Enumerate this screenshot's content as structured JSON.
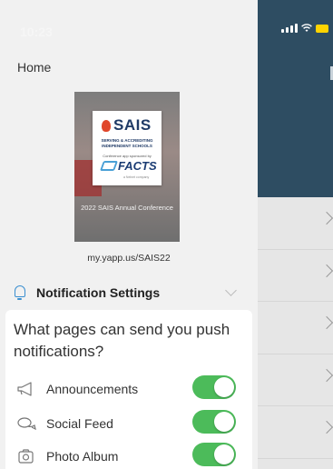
{
  "status_bar": {
    "time": "10:23"
  },
  "drawer": {
    "home_label": "Home",
    "cover": {
      "logo_text": "SAIS",
      "tagline": "SERVING & ACCREDITING INDEPENDENT SCHOOLS",
      "sponsor_text": "Conference app sponsored by",
      "sponsor_logo": "FACTS",
      "sponsor_byline": "a Nelnet company",
      "caption": "2022 SAIS Annual Conference"
    },
    "url": "my.yapp.us/SAIS22",
    "notifications": {
      "title": "Notification Settings",
      "question": "What pages can send you push notifications?",
      "options": [
        {
          "icon": "megaphone-icon",
          "label": "Announcements",
          "enabled": true
        },
        {
          "icon": "chat-bubbles-icon",
          "label": "Social Feed",
          "enabled": true
        },
        {
          "icon": "camera-icon",
          "label": "Photo Album",
          "enabled": true
        }
      ]
    }
  },
  "colors": {
    "header": "#2e4d62",
    "toggle_on": "#4cbb5a",
    "accent": "#3b8fd0",
    "battery": "#ffd400"
  }
}
